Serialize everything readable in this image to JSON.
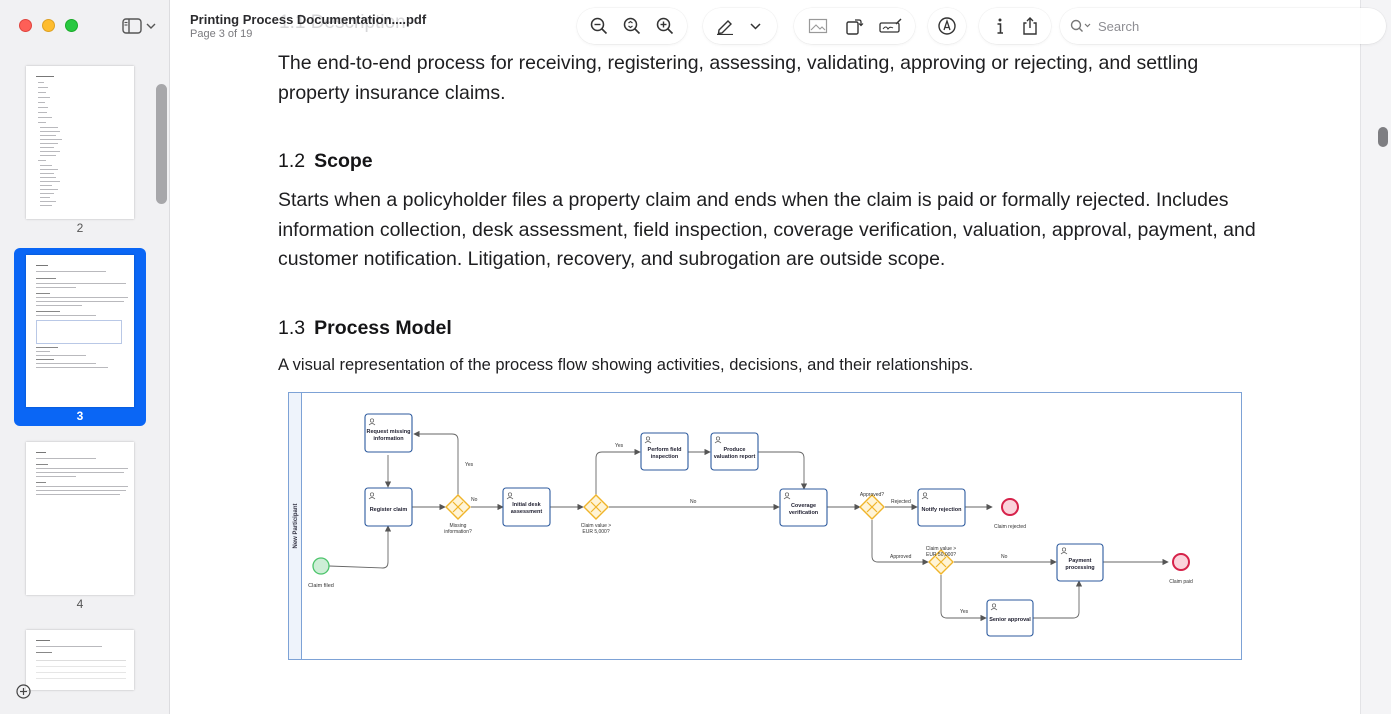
{
  "window": {
    "title": "Printing Process Documentation....pdf",
    "subtitle": "Page 3 of 19"
  },
  "toolbar": {
    "buttons": [
      "zoom-out-icon",
      "zoom-fit-icon",
      "zoom-in-icon",
      "highlight-pen-icon",
      "chevron-down-icon",
      "image-icon",
      "rotate-icon",
      "signature-icon",
      "markup-icon",
      "info-icon",
      "share-icon"
    ]
  },
  "search": {
    "placeholder": "Search"
  },
  "sidebar": {
    "thumbnails": [
      {
        "label": "2"
      },
      {
        "label": "3",
        "selected": true
      },
      {
        "label": "4"
      }
    ]
  },
  "document": {
    "ghost_heading": "1.1 Description",
    "description_para": "The end-to-end process for receiving, registering, assessing, validating, approving or rejecting, and settling property insurance claims.",
    "scope_num": "1.2",
    "scope_title": "Scope",
    "scope_para": "Starts when a policyholder files a property claim and ends when the claim is paid or formally rejected. Includes information collection, desk assessment, field inspection, coverage verification, valuation, approval, payment, and customer notification. Litigation, recovery, and subrogation are outside scope.",
    "model_num": "1.3",
    "model_title": "Process Model",
    "model_para": "A visual representation of the process flow showing activities, decisions, and their relationships."
  },
  "diagram": {
    "lane": "New Participant",
    "tasks": {
      "request": [
        "Request missing",
        "information"
      ],
      "register": [
        "Register claim"
      ],
      "desk": [
        "Initial desk",
        "assessment"
      ],
      "inspect": [
        "Perform field",
        "inspection"
      ],
      "valuation": [
        "Produce",
        "valuation report"
      ],
      "coverage": [
        "Coverage",
        "verification"
      ],
      "notify": [
        "Notify rejection"
      ],
      "payment": [
        "Payment",
        "processing"
      ],
      "senior": [
        "Senior approval"
      ]
    },
    "gateways": {
      "missing": [
        "Missing",
        "information?"
      ],
      "value1": [
        "Claim value >",
        "EUR 5,000?"
      ],
      "approved": [
        "Approved?"
      ],
      "value2": [
        "Claim value >",
        "EUR 50,000?"
      ]
    },
    "events": {
      "start": "Claim filed",
      "rejected": "Claim rejected",
      "paid": "Claim paid"
    },
    "flow_labels": {
      "yes": "Yes",
      "no": "No",
      "rejected": "Rejected",
      "approved": "Approved"
    }
  },
  "colors": {
    "accent": "#0a66f5",
    "task_border": "#2c5a9e",
    "gateway": "#f0b429",
    "start_event": "#4cc46b",
    "end_event": "#d6224a"
  }
}
